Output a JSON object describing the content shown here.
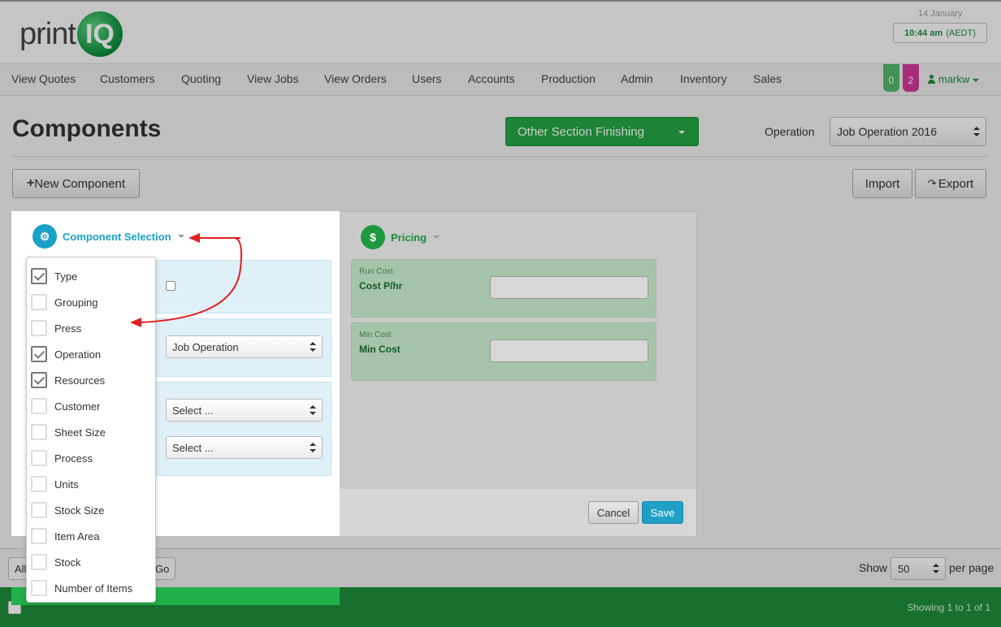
{
  "header": {
    "logo_print": "print",
    "logo_iq": "IQ",
    "date": "14 January",
    "time": "10:44 am",
    "timezone": "(AEDT)"
  },
  "nav": {
    "items": [
      "View Quotes",
      "Customers",
      "Quoting",
      "View Jobs",
      "View Orders",
      "Users",
      "Accounts",
      "Production",
      "Admin",
      "Inventory",
      "Sales"
    ],
    "badge_green": "0",
    "badge_pink": "2",
    "user": "markw"
  },
  "page": {
    "title": "Components",
    "section_dropdown": "Other Section Finishing",
    "operation_label": "Operation",
    "operation_value": "Job Operation 2016",
    "new_component": "New Component",
    "import": "Import",
    "export": "Export"
  },
  "modal": {
    "component_selection": "Component Selection",
    "pricing": "Pricing",
    "operation_select": "Job Operation",
    "select_placeholder_1": "Select ...",
    "select_placeholder_2": "Select ...",
    "run_cost_small": "Run Cost",
    "run_cost_label": "Cost P/hr",
    "min_cost_small": "Min Cost",
    "min_cost_label": "Min Cost",
    "cancel": "Cancel",
    "save": "Save"
  },
  "dropdown": {
    "items": [
      {
        "label": "Type",
        "checked": true
      },
      {
        "label": "Grouping",
        "checked": false
      },
      {
        "label": "Press",
        "checked": false
      },
      {
        "label": "Operation",
        "checked": true
      },
      {
        "label": "Resources",
        "checked": true
      },
      {
        "label": "Customer",
        "checked": false
      },
      {
        "label": "Sheet Size",
        "checked": false
      },
      {
        "label": "Process",
        "checked": false
      },
      {
        "label": "Units",
        "checked": false
      },
      {
        "label": "Stock Size",
        "checked": false
      },
      {
        "label": "Item Area",
        "checked": false
      },
      {
        "label": "Stock",
        "checked": false
      },
      {
        "label": "Number of Items",
        "checked": false
      }
    ]
  },
  "bottom": {
    "all_select": "All",
    "go": "Go",
    "show_label": "Show",
    "show_value": "50",
    "per_page": "per page",
    "showing": "Showing 1 to 1 of 1"
  },
  "colors": {
    "accent_green": "#24a541",
    "accent_blue": "#1ba0c8",
    "badge_pink": "#d1389a",
    "annotation_red": "#e02020"
  }
}
